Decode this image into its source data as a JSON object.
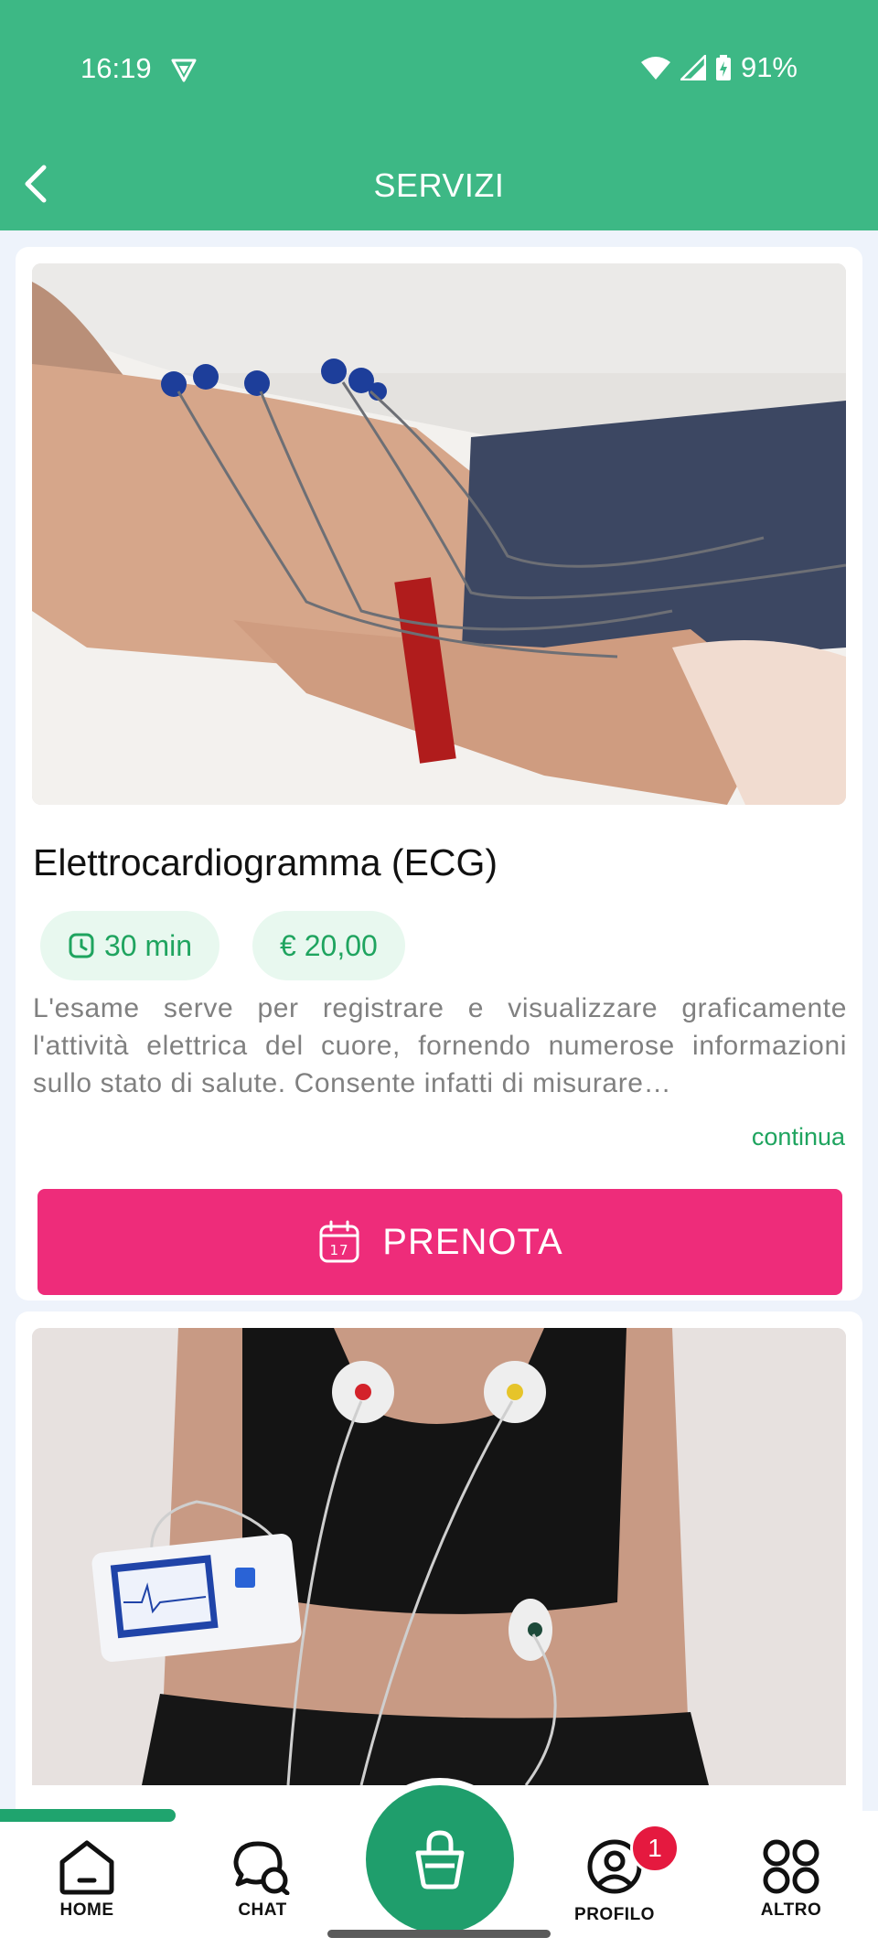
{
  "status_bar": {
    "time": "16:19",
    "battery": "91%"
  },
  "header": {
    "title": "SERVIZI"
  },
  "services": [
    {
      "name": "Elettrocardiogramma (ECG)",
      "duration": "30 min",
      "price": "€ 20,00",
      "description": "L'esame serve per registrare e visualizzare graficamente l'attività elettrica del cuore, fornendo numerose informazioni sullo stato di salute. Consente infatti di misurare…",
      "more_label": "continua",
      "book_label": "PRENOTA"
    }
  ],
  "bottom_nav": {
    "home": "HOME",
    "chat": "CHAT",
    "profile": "PROFILO",
    "profile_badge": "1",
    "more": "ALTRO"
  },
  "colors": {
    "header": "#3db885",
    "accent_green": "#1fa45f",
    "book_button": "#ee2c7a",
    "fab": "#1f9e6c",
    "badge": "#e5193f"
  }
}
